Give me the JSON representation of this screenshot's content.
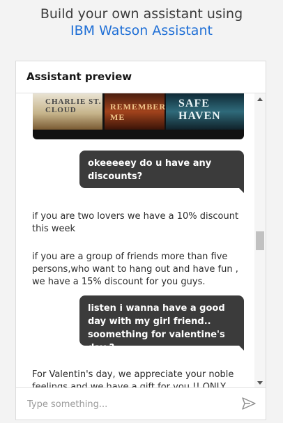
{
  "header": {
    "line1": "Build your own assistant using",
    "link": "IBM Watson Assistant"
  },
  "panel": {
    "title": "Assistant preview"
  },
  "carousel": {
    "posters": [
      {
        "title": "CHARLIE ST. CLOUD"
      },
      {
        "title": "REMEMBER ME"
      },
      {
        "title": "SAFE HAVEN"
      }
    ]
  },
  "messages": [
    {
      "from": "user",
      "text": "okeeeeey do u have any discounts?"
    },
    {
      "from": "assistant",
      "text": "if you are two lovers we have a 10% discount this week"
    },
    {
      "from": "assistant",
      "text": "if you are a group of friends more than five persons,who want to hang out and have fun , we have a 15% discount for you guys."
    },
    {
      "from": "user",
      "text": "listen i wanna have a good day with my girl friend.. soomething for valentine's day ?"
    },
    {
      "from": "assistant",
      "text": "For Valentin's day, we appreciate your noble feelings and we have a gift for you !! ONLY one"
    }
  ],
  "input": {
    "placeholder": "Type something..."
  },
  "icons": {
    "send": "send-icon",
    "scroll_up": "chevron-up-icon",
    "scroll_down": "chevron-down-icon"
  },
  "colors": {
    "accent": "#1f6fd6",
    "user_bubble": "#3b3b3b",
    "background": "#f3f3f3"
  }
}
